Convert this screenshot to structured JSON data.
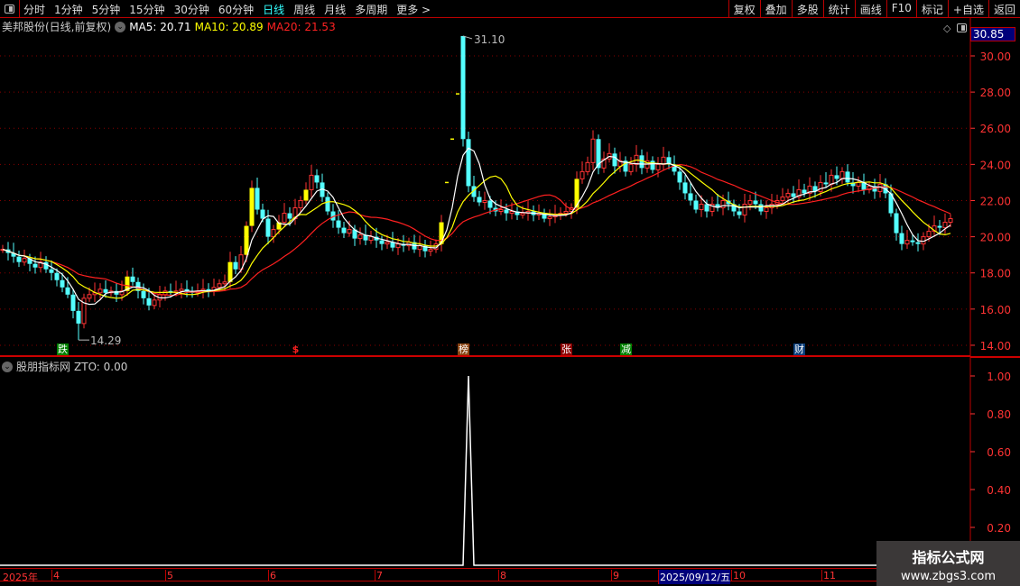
{
  "toolbar": {
    "periods": [
      "分时",
      "1分钟",
      "5分钟",
      "15分钟",
      "30分钟",
      "60分钟",
      "日线",
      "周线",
      "月线",
      "多周期",
      "更多 >"
    ],
    "active": "日线",
    "buttons": [
      "复权",
      "叠加",
      "多股",
      "统计",
      "画线",
      "F10",
      "标记",
      "+自选",
      "返回"
    ]
  },
  "info": {
    "title": "美邦股份(日线,前复权)",
    "ma5": "MA5: 20.71",
    "ma10": "MA10: 20.89",
    "ma20": "MA20: 21.53"
  },
  "current_price": "30.85",
  "colors": {
    "up": "#ff3333",
    "down": "#54ffff",
    "ma5": "#ffffff",
    "ma10": "#ffff00",
    "ma20": "#ff2020",
    "highlight": "#ffff00",
    "axis": "#ff3333"
  },
  "indicator": {
    "title": "股朋指标网",
    "value": "ZTO: 0.00"
  },
  "signals": [
    {
      "text": "跌",
      "bg": "#008000",
      "index": 11
    },
    {
      "text": "$",
      "bg": "transparent",
      "color": "#ff2020",
      "index": 54
    },
    {
      "text": "榜",
      "bg": "#8b4513",
      "index": 85
    },
    {
      "text": "张",
      "bg": "#8b0000",
      "index": 104
    },
    {
      "text": "减",
      "bg": "#008000",
      "index": 115
    },
    {
      "text": "财",
      "bg": "#0a3d7a",
      "index": 147
    }
  ],
  "date_axis": {
    "year": "2025年",
    "months": [
      "4",
      "5",
      "6",
      "7",
      "8",
      "9",
      "10",
      "11"
    ],
    "selected": "2025/09/12/五"
  },
  "watermark": {
    "line1": "指标公式网",
    "line2": "www.zbgs3.com"
  },
  "chart_data": [
    {
      "type": "candlestick",
      "ylim": [
        13.5,
        31.5
      ],
      "yticks": [
        "30.00",
        "28.00",
        "26.00",
        "24.00",
        "22.00",
        "20.00",
        "18.00",
        "16.00",
        "14.00"
      ],
      "high_label": "31.10",
      "low_label": "14.29",
      "high": 31.1,
      "low": 14.29,
      "close": [
        19.3,
        19.1,
        18.9,
        18.6,
        18.8,
        18.5,
        18.3,
        18.6,
        18.2,
        18.0,
        17.6,
        17.2,
        16.8,
        15.9,
        15.2,
        16.6,
        16.8,
        16.9,
        17.1,
        16.9,
        17.0,
        16.8,
        17.0,
        17.8,
        17.5,
        17.0,
        16.6,
        16.2,
        16.5,
        16.8,
        17.0,
        16.9,
        17.0,
        17.1,
        17.0,
        16.9,
        17.0,
        17.1,
        17.0,
        17.2,
        17.4,
        17.5,
        18.6,
        18.2,
        19.0,
        20.6,
        22.7,
        21.5,
        21.0,
        20.0,
        20.4,
        20.8,
        21.3,
        21.0,
        21.6,
        22.0,
        22.6,
        23.4,
        23.0,
        22.2,
        21.4,
        20.9,
        20.5,
        20.2,
        20.4,
        19.9,
        20.1,
        19.8,
        20.0,
        19.8,
        19.6,
        19.7,
        19.4,
        19.6,
        19.5,
        19.7,
        19.3,
        19.5,
        19.2,
        19.3,
        19.6,
        20.8,
        23.0,
        25.4,
        27.9,
        25.4,
        22.8,
        22.2,
        21.9,
        22.0,
        21.6,
        21.4,
        21.5,
        21.3,
        21.4,
        21.2,
        21.3,
        21.4,
        21.2,
        21.3,
        21.0,
        21.1,
        21.2,
        21.3,
        21.4,
        21.6,
        23.2,
        23.6,
        24.1,
        25.4,
        23.8,
        24.3,
        24.6,
        23.9,
        24.2,
        23.6,
        24.0,
        24.5,
        23.8,
        24.2,
        23.7,
        24.0,
        24.4,
        24.0,
        23.6,
        23.0,
        22.4,
        22.0,
        21.5,
        21.8,
        21.4,
        21.8,
        21.6,
        22.0,
        21.8,
        21.4,
        21.2,
        21.8,
        22.0,
        21.8,
        21.4,
        21.6,
        21.8,
        22.0,
        22.2,
        22.4,
        22.2,
        22.6,
        22.4,
        22.8,
        22.5,
        23.0,
        22.9,
        23.4,
        23.2,
        23.6,
        23.0,
        22.8,
        23.0,
        22.6,
        22.8,
        22.5,
        22.9,
        22.4,
        21.3,
        20.2,
        19.6,
        19.8,
        19.7,
        19.6,
        20.0,
        20.3,
        20.6,
        20.5,
        20.8,
        21.0
      ],
      "highlighted": [
        23,
        42,
        45,
        46,
        51,
        56,
        81,
        106
      ],
      "one_price": [
        82,
        83,
        84
      ],
      "high_index": 85,
      "low_index": 14
    },
    {
      "type": "line",
      "name": "ZTO",
      "ylim": [
        0,
        1.05
      ],
      "yticks": [
        "1.00",
        "0.80",
        "0.60",
        "0.40",
        "0.20"
      ],
      "spike_index": 86,
      "spike_value": 1.0
    }
  ]
}
